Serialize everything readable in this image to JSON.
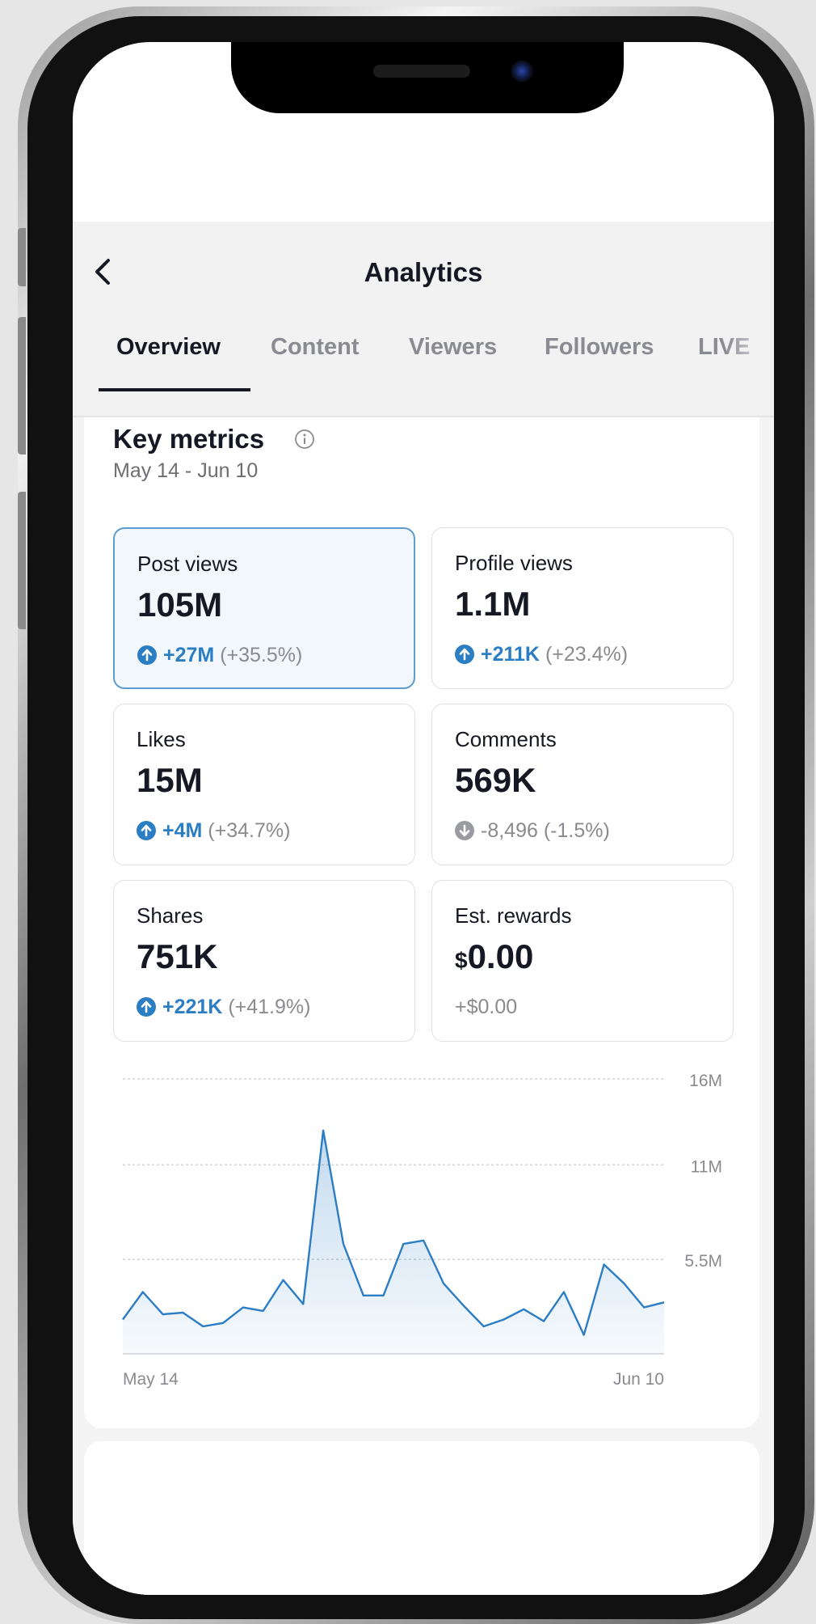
{
  "header": {
    "title": "Analytics"
  },
  "tabs": [
    {
      "label": "Overview",
      "active": true
    },
    {
      "label": "Content",
      "active": false
    },
    {
      "label": "Viewers",
      "active": false
    },
    {
      "label": "Followers",
      "active": false
    },
    {
      "label": "LIVE",
      "active": false
    }
  ],
  "key_metrics": {
    "title": "Key metrics",
    "date_range": "May 14 - Jun 10",
    "cards": [
      {
        "label": "Post views",
        "value": "105M",
        "change_abs": "+27M",
        "change_pct": "(+35.5%)",
        "trend": "up",
        "selected": true
      },
      {
        "label": "Profile views",
        "value": "1.1M",
        "change_abs": "+211K",
        "change_pct": "(+23.4%)",
        "trend": "up",
        "selected": false
      },
      {
        "label": "Likes",
        "value": "15M",
        "change_abs": "+4M",
        "change_pct": "(+34.7%)",
        "trend": "up",
        "selected": false
      },
      {
        "label": "Comments",
        "value": "569K",
        "change_abs": "-8,496",
        "change_pct": "(-1.5%)",
        "trend": "down",
        "selected": false
      },
      {
        "label": "Shares",
        "value": "751K",
        "change_abs": "+221K",
        "change_pct": "(+41.9%)",
        "trend": "up",
        "selected": false
      },
      {
        "label": "Est. rewards",
        "currency": "$",
        "value": "0.00",
        "change_abs": "+$0.00",
        "change_pct": "",
        "trend": "none",
        "selected": false
      }
    ]
  },
  "colors": {
    "accent": "#2b7dc4",
    "selected_border": "#5e9bd0",
    "text_primary": "#161823",
    "text_secondary": "#8a8b91"
  },
  "icons": {
    "back": "chevron-left-icon",
    "info": "info-icon",
    "up": "arrow-up-circle-icon",
    "down": "arrow-down-circle-icon"
  },
  "chart_data": {
    "type": "area",
    "title": "",
    "xlabel": "",
    "ylabel": "",
    "x_start_label": "May 14",
    "x_end_label": "Jun 10",
    "y_tick_labels": [
      "16M",
      "11M",
      "5.5M"
    ],
    "y_ticks": [
      16,
      11,
      5.5
    ],
    "ylim": [
      0,
      16
    ],
    "grid": true,
    "series": [
      {
        "values": [
          2.0,
          3.6,
          2.3,
          2.4,
          1.6,
          1.8,
          2.7,
          2.5,
          4.3,
          2.9,
          13.0,
          6.4,
          3.4,
          3.4,
          6.4,
          6.6,
          4.1,
          2.8,
          1.6,
          2.0,
          2.6,
          1.9,
          3.6,
          1.1,
          5.2,
          4.1,
          2.7,
          3.0
        ]
      }
    ]
  }
}
